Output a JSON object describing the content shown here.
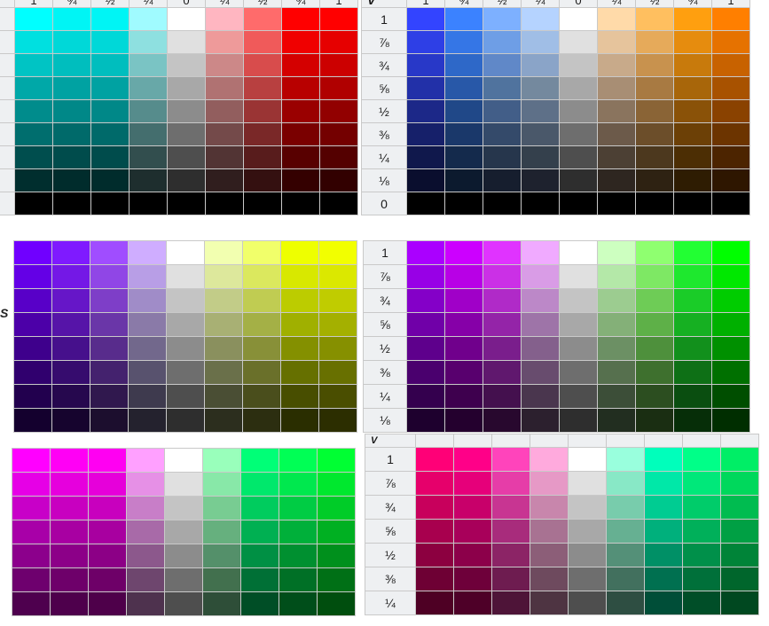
{
  "axis": {
    "v_label": "V",
    "s_label": "S"
  },
  "column_headers": [
    "1",
    "¾",
    "½",
    "¼",
    "0",
    "¼",
    "½",
    "¾",
    "1"
  ],
  "value_rows": [
    "1",
    "⅞",
    "¾",
    "⅝",
    "½",
    "⅜",
    "¼",
    "⅛",
    "0"
  ],
  "panels": [
    {
      "id": "cyan-red",
      "rows": [
        [
          "#00ffff",
          "#00f5f5",
          "#00f5f5",
          "#a0fbff",
          "#ffffff",
          "#ffb6c1",
          "#ff6b6b",
          "#ff0000",
          "#ff0000"
        ],
        [
          "#00e0e0",
          "#00d8d8",
          "#00d8d8",
          "#8ee0e0",
          "#e0e0e0",
          "#ee9a9a",
          "#f05a5a",
          "#f00000",
          "#e60000"
        ],
        [
          "#00c4c4",
          "#00bebe",
          "#00bebe",
          "#7ac4c4",
          "#c4c4c4",
          "#cc8888",
          "#d84c4c",
          "#d40000",
          "#cc0000"
        ],
        [
          "#00a8a8",
          "#00a2a2",
          "#00a2a2",
          "#68a8a8",
          "#a8a8a8",
          "#b07272",
          "#b84040",
          "#b80000",
          "#b00000"
        ],
        [
          "#008c8c",
          "#008888",
          "#008888",
          "#568c8c",
          "#8c8c8c",
          "#925e5e",
          "#9a3434",
          "#9a0000",
          "#920000"
        ],
        [
          "#006e6e",
          "#006a6a",
          "#006a6a",
          "#446e6e",
          "#6e6e6e",
          "#744a4a",
          "#7a2828",
          "#7a0000",
          "#740000"
        ],
        [
          "#004e4e",
          "#004c4c",
          "#004c4c",
          "#324e4e",
          "#4e4e4e",
          "#523434",
          "#581c1c",
          "#580000",
          "#540000"
        ],
        [
          "#002e2e",
          "#002c2c",
          "#002c2c",
          "#1e2e2e",
          "#2e2e2e",
          "#301e1e",
          "#341010",
          "#340000",
          "#320000"
        ],
        [
          "#000000",
          "#000000",
          "#000000",
          "#000000",
          "#000000",
          "#000000",
          "#000000",
          "#000000",
          "#000000"
        ]
      ]
    },
    {
      "id": "blue-orange",
      "rows": [
        [
          "#3344ff",
          "#3b82ff",
          "#7db0ff",
          "#b5d3ff",
          "#ffffff",
          "#ffdaa9",
          "#ffbf5f",
          "#ff9f0f",
          "#ff7f00"
        ],
        [
          "#2e3fe6",
          "#3576e6",
          "#6e9ee6",
          "#a0bee6",
          "#e0e0e0",
          "#e6c49c",
          "#e6aa5a",
          "#e68c0e",
          "#e67200"
        ],
        [
          "#2838c8",
          "#2e68c8",
          "#6088c8",
          "#8aa4c8",
          "#c4c4c4",
          "#c8aa8a",
          "#c8924e",
          "#c87a0c",
          "#c86200"
        ],
        [
          "#2230a8",
          "#2858a8",
          "#50739e",
          "#74899e",
          "#a8a8a8",
          "#a88e74",
          "#a87a42",
          "#a8660a",
          "#a85200"
        ],
        [
          "#1c2888",
          "#204888",
          "#425e88",
          "#5e7088",
          "#8c8c8c",
          "#8a745e",
          "#8a6436",
          "#8a5208",
          "#8a4200"
        ],
        [
          "#16206a",
          "#1a386a",
          "#344a6a",
          "#4a586a",
          "#6e6e6e",
          "#6c5a4a",
          "#6c4e2a",
          "#6c4006",
          "#6c3400"
        ],
        [
          "#10184c",
          "#142a4c",
          "#26364c",
          "#34404c",
          "#4e4e4e",
          "#4c4034",
          "#4c381e",
          "#4c2e04",
          "#4c2400"
        ],
        [
          "#0a0e2e",
          "#0c1a2e",
          "#161e2e",
          "#1e222e",
          "#2e2e2e",
          "#2e2620",
          "#2e2212",
          "#2e1c02",
          "#2e1600"
        ],
        [
          "#000000",
          "#000000",
          "#000000",
          "#000000",
          "#000000",
          "#000000",
          "#000000",
          "#000000",
          "#000000"
        ]
      ]
    },
    {
      "id": "violet-yellow",
      "rows": [
        [
          "#7000ff",
          "#7f1aff",
          "#a04dff",
          "#cfadff",
          "#ffffff",
          "#f2ffb0",
          "#f1ff6a",
          "#eeff00",
          "#f2ff00"
        ],
        [
          "#6400e6",
          "#7418e6",
          "#9046e6",
          "#b89ee6",
          "#e0e0e0",
          "#dde89c",
          "#dbe85e",
          "#d8e800",
          "#dbe800"
        ],
        [
          "#5800c8",
          "#6616c8",
          "#7e3ec8",
          "#a08cc8",
          "#c4c4c4",
          "#c2cc88",
          "#c0cc52",
          "#bccc00",
          "#c0cc00"
        ],
        [
          "#4c00a8",
          "#5614a8",
          "#6a36a8",
          "#8a7aa8",
          "#a8a8a8",
          "#a8b074",
          "#a4b046",
          "#a0b000",
          "#a4b000"
        ],
        [
          "#3e008c",
          "#46108c",
          "#582c8c",
          "#72688c",
          "#8c8c8c",
          "#8a905e",
          "#889038",
          "#849000",
          "#869000"
        ],
        [
          "#30006e",
          "#360c6e",
          "#44226e",
          "#58526e",
          "#6e6e6e",
          "#6a704a",
          "#6a702a",
          "#667000",
          "#687000"
        ],
        [
          "#22004e",
          "#26084e",
          "#30184e",
          "#3e3a4e",
          "#4e4e4e",
          "#4a4e34",
          "#4a4e1c",
          "#484e00",
          "#4a4e00"
        ],
        [
          "#14002e",
          "#16042e",
          "#1c0e2e",
          "#24222e",
          "#2e2e2e",
          "#2c2e1e",
          "#2c2e10",
          "#2a2e00",
          "#2c2e00"
        ]
      ]
    },
    {
      "id": "purple-green",
      "rows": [
        [
          "#aa00ff",
          "#cc00ff",
          "#e033ff",
          "#f0aaff",
          "#ffffff",
          "#cdffc0",
          "#8fff70",
          "#22ff33",
          "#00ff00"
        ],
        [
          "#9800e6",
          "#b800e6",
          "#cb30e6",
          "#d99ce6",
          "#e0e0e0",
          "#b4e8a8",
          "#7ee864",
          "#1ee82e",
          "#00e800"
        ],
        [
          "#8400c8",
          "#a000c8",
          "#b02ac8",
          "#bc88c8",
          "#c4c4c4",
          "#9ccc90",
          "#6ecc56",
          "#1acc28",
          "#00cc00"
        ],
        [
          "#7000a8",
          "#8600a8",
          "#9424a8",
          "#9e74a8",
          "#a8a8a8",
          "#84b078",
          "#5eb048",
          "#16b022",
          "#00b000"
        ],
        [
          "#5e008c",
          "#70008c",
          "#7a1e8c",
          "#84608c",
          "#8c8c8c",
          "#6c9064",
          "#4e903c",
          "#12901c",
          "#009000"
        ],
        [
          "#4a006e",
          "#58006e",
          "#60186e",
          "#684c6e",
          "#6e6e6e",
          "#56704e",
          "#3e702e",
          "#0e7016",
          "#007000"
        ],
        [
          "#34004e",
          "#3e004e",
          "#44104e",
          "#4a364e",
          "#4e4e4e",
          "#3c4e38",
          "#2c4e20",
          "#0a4e10",
          "#004e00"
        ],
        [
          "#1e002e",
          "#24002e",
          "#28082e",
          "#2c202e",
          "#2e2e2e",
          "#222e20",
          "#1a2e12",
          "#062e08",
          "#002e00"
        ]
      ]
    },
    {
      "id": "magenta-green",
      "rows": [
        [
          "#ff00ff",
          "#ff00f5",
          "#ff00f2",
          "#ffa0ff",
          "#ffffff",
          "#99ffbb",
          "#00ff77",
          "#00ff55",
          "#00ff33"
        ],
        [
          "#e600e6",
          "#e600dd",
          "#e600da",
          "#e690e6",
          "#e0e0e0",
          "#88e8a8",
          "#00e86c",
          "#00e84e",
          "#00e82e"
        ],
        [
          "#c800c8",
          "#c800c0",
          "#c800be",
          "#c87ec8",
          "#c4c4c4",
          "#78cc92",
          "#00cc5e",
          "#00cc44",
          "#00cc28"
        ],
        [
          "#a800a8",
          "#a800a2",
          "#a800a0",
          "#a86aa8",
          "#a8a8a8",
          "#66b07e",
          "#00b052",
          "#00b03a",
          "#00b022"
        ],
        [
          "#8c008c",
          "#8c0088",
          "#8c0086",
          "#8c588c",
          "#8c8c8c",
          "#54906a",
          "#009044",
          "#009030",
          "#00901c"
        ],
        [
          "#6e006e",
          "#6e006a",
          "#6e0068",
          "#6e466e",
          "#6e6e6e",
          "#42704e",
          "#007036",
          "#007026",
          "#007016"
        ],
        [
          "#4e004e",
          "#4e004c",
          "#4e004a",
          "#4e324e",
          "#4e4e4e",
          "#2e4e38",
          "#004e26",
          "#004e1a",
          "#004e0e"
        ]
      ]
    },
    {
      "id": "rose-spring",
      "rows": [
        [
          "#ff0077",
          "#ff0088",
          "#ff44bb",
          "#ffaadd",
          "#ffffff",
          "#99ffdd",
          "#00ffbb",
          "#00ff88",
          "#00ee66"
        ],
        [
          "#e6006b",
          "#e6007a",
          "#e63da8",
          "#e699c6",
          "#e0e0e0",
          "#88e8c6",
          "#00e8a8",
          "#00e87a",
          "#00d85c"
        ],
        [
          "#c8005c",
          "#c8006a",
          "#c83592",
          "#c886ac",
          "#c4c4c4",
          "#78ccac",
          "#00cc92",
          "#00cc6a",
          "#00bc50"
        ],
        [
          "#a8004e",
          "#a8005a",
          "#a82c7c",
          "#a87292",
          "#a8a8a8",
          "#66b092",
          "#00b07c",
          "#00b05a",
          "#00a044"
        ],
        [
          "#8c0040",
          "#8c004a",
          "#8c2466",
          "#8c5e78",
          "#8c8c8c",
          "#549078",
          "#009066",
          "#00904a",
          "#008438"
        ],
        [
          "#6e0034",
          "#6e003a",
          "#6e1c50",
          "#6e4a5e",
          "#6e6e6e",
          "#42705e",
          "#007050",
          "#00703a",
          "#00662c"
        ],
        [
          "#4e0024",
          "#4e0028",
          "#4e1438",
          "#4e3442",
          "#4e4e4e",
          "#2e4e42",
          "#004e38",
          "#004e28",
          "#004820"
        ]
      ]
    }
  ]
}
